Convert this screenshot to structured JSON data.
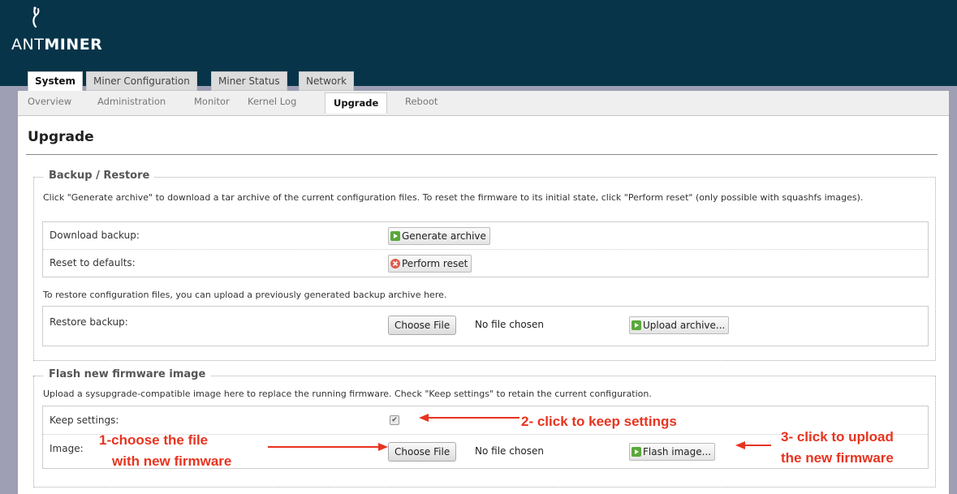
{
  "header": {
    "logo_text_ant": "ANT",
    "logo_text_miner": "MINER"
  },
  "main_tabs": [
    {
      "label": "System",
      "active": true
    },
    {
      "label": "Miner Configuration",
      "active": false
    },
    {
      "label": "Miner Status",
      "active": false
    },
    {
      "label": "Network",
      "active": false
    }
  ],
  "sub_tabs": [
    {
      "label": "Overview",
      "active": false
    },
    {
      "label": "Administration",
      "active": false
    },
    {
      "label": "Monitor",
      "active": false
    },
    {
      "label": "Kernel Log",
      "active": false
    },
    {
      "label": "Upgrade",
      "active": true
    },
    {
      "label": "Reboot",
      "active": false
    }
  ],
  "page": {
    "title": "Upgrade"
  },
  "backup": {
    "legend": "Backup / Restore",
    "description": "Click \"Generate archive\" to download a tar archive of the current configuration files. To reset the firmware to its initial state, click \"Perform reset\" (only possible with squashfs images).",
    "download_label": "Download backup:",
    "generate_button": "Generate archive",
    "reset_label": "Reset to defaults:",
    "reset_button": "Perform reset",
    "restore_description": "To restore configuration files, you can upload a previously generated backup archive here.",
    "restore_label": "Restore backup:",
    "choose_file_button": "Choose File",
    "no_file_text": "No file chosen",
    "upload_button": "Upload archive..."
  },
  "flash": {
    "legend": "Flash new firmware image",
    "description": "Upload a sysupgrade-compatible image here to replace the running firmware. Check \"Keep settings\" to retain the current configuration.",
    "keep_label": "Keep settings:",
    "keep_checked": true,
    "image_label": "Image:",
    "choose_file_button": "Choose File",
    "no_file_text": "No file chosen",
    "flash_button": "Flash image..."
  },
  "annotations": {
    "step1_line1": "1-choose the file",
    "step1_line2": "with new firmware",
    "step2": "2- click to keep settings",
    "step3_line1": "3- click to upload",
    "step3_line2": "the new firmware",
    "color": "#e8331f"
  },
  "colors": {
    "header_bg": "#073449",
    "page_bg": "#9e9eb4"
  }
}
